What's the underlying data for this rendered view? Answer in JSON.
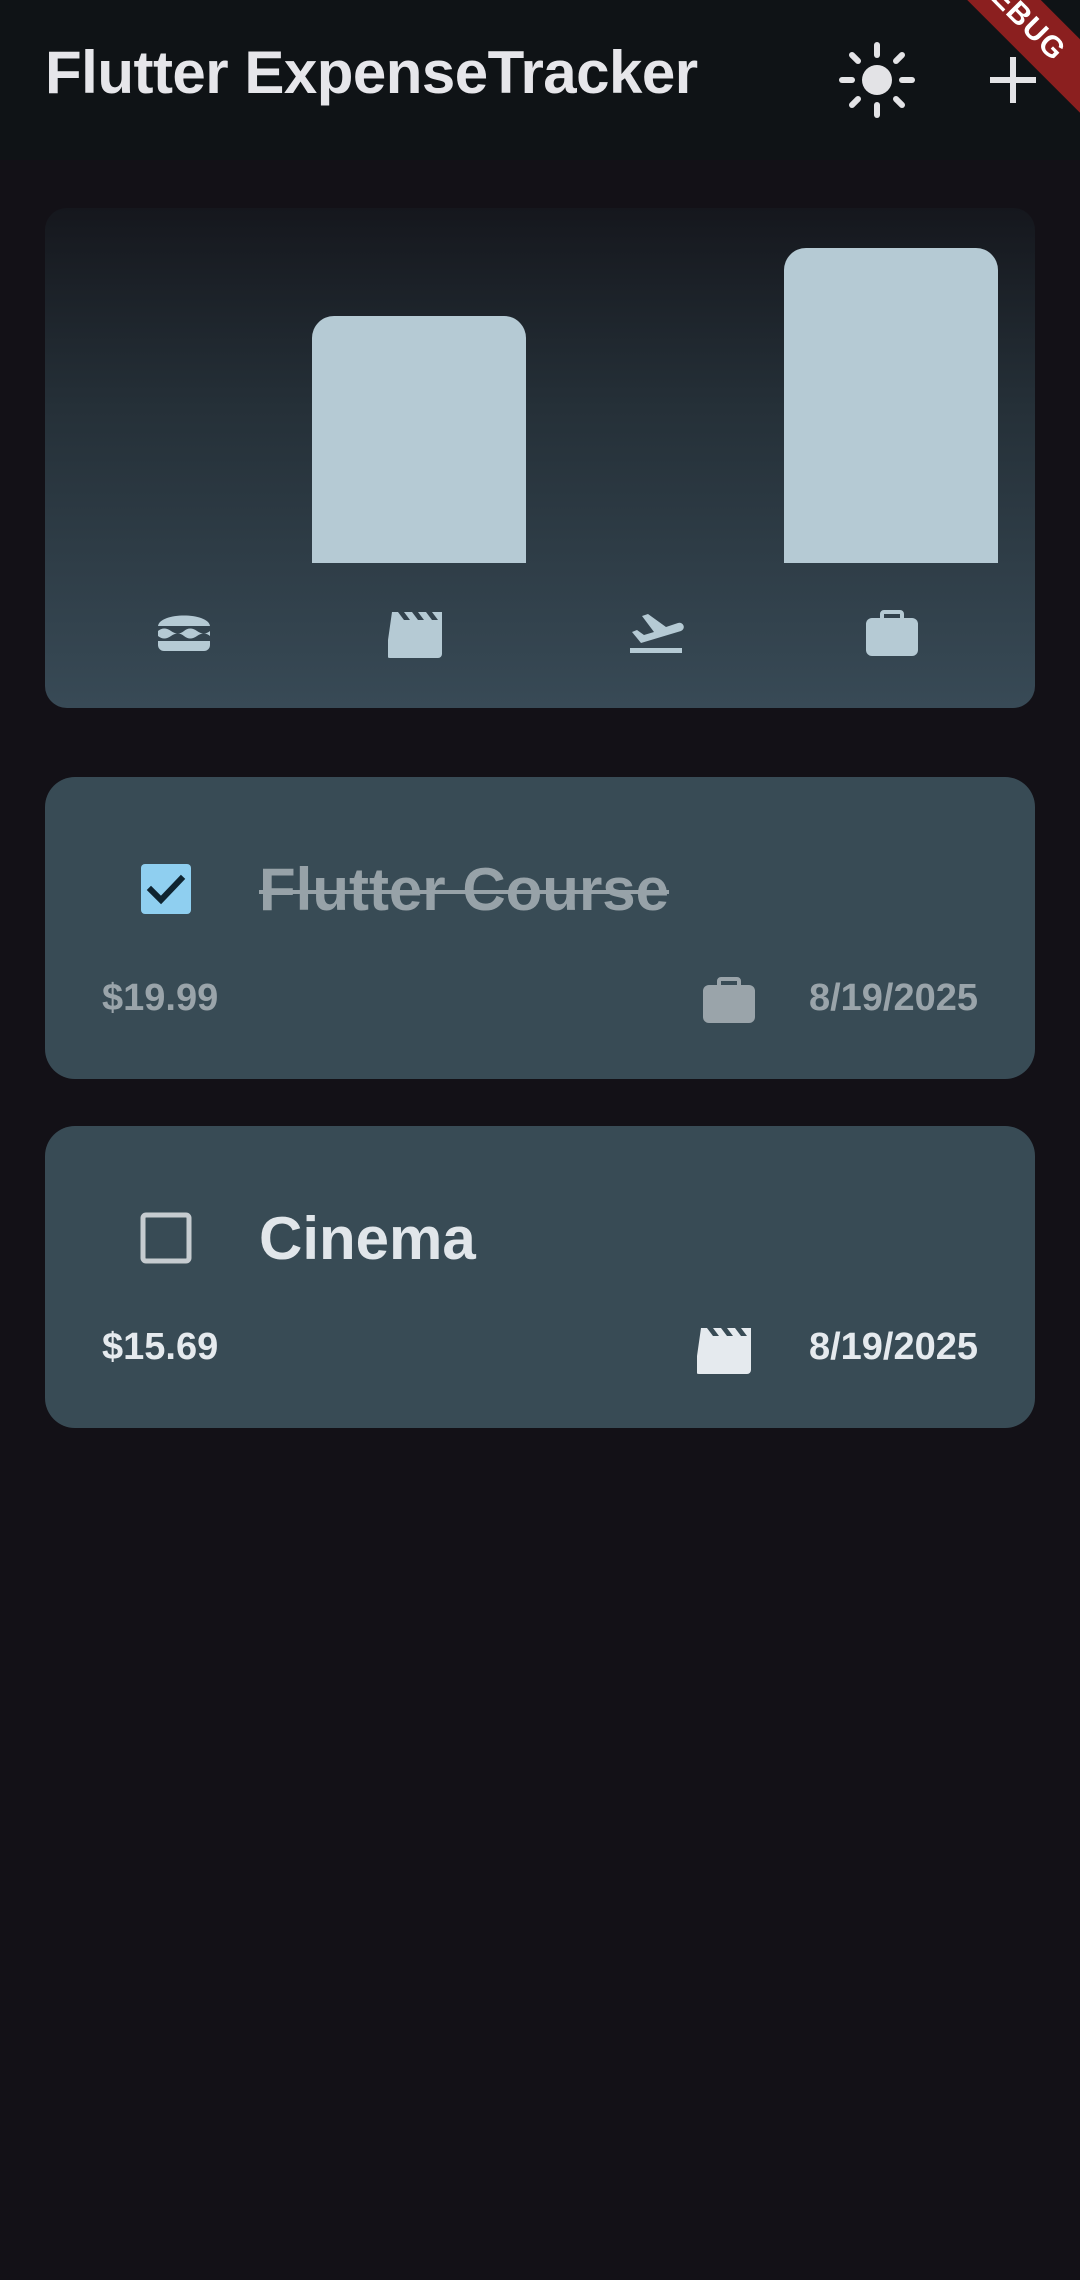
{
  "appbar": {
    "title": "Flutter ExpenseTracker",
    "theme_icon": "sun-icon",
    "add_icon": "plus-icon"
  },
  "debug_banner": "DEBUG",
  "colors": {
    "background": "#131117",
    "appbar": "#0f1316",
    "card": "#384b55",
    "bar": "#b5cad4",
    "checkbox_checked": "#8fcff0",
    "debug_banner": "#8b1f1f"
  },
  "chart_data": {
    "type": "bar",
    "categories": [
      "food",
      "leisure",
      "travel",
      "work"
    ],
    "category_icons": [
      "burger-icon",
      "movie-clapper-icon",
      "flight-takeoff-icon",
      "briefcase-icon"
    ],
    "values": [
      0,
      15.69,
      0,
      19.99
    ],
    "ylim": [
      0,
      19.99
    ],
    "grid": false,
    "legend": "none"
  },
  "expenses": [
    {
      "title": "Flutter Course",
      "amount": "$19.99",
      "date": "8/19/2025",
      "category_icon": "briefcase-icon",
      "checked": true
    },
    {
      "title": "Cinema",
      "amount": "$15.69",
      "date": "8/19/2025",
      "category_icon": "movie-clapper-icon",
      "checked": false
    }
  ]
}
